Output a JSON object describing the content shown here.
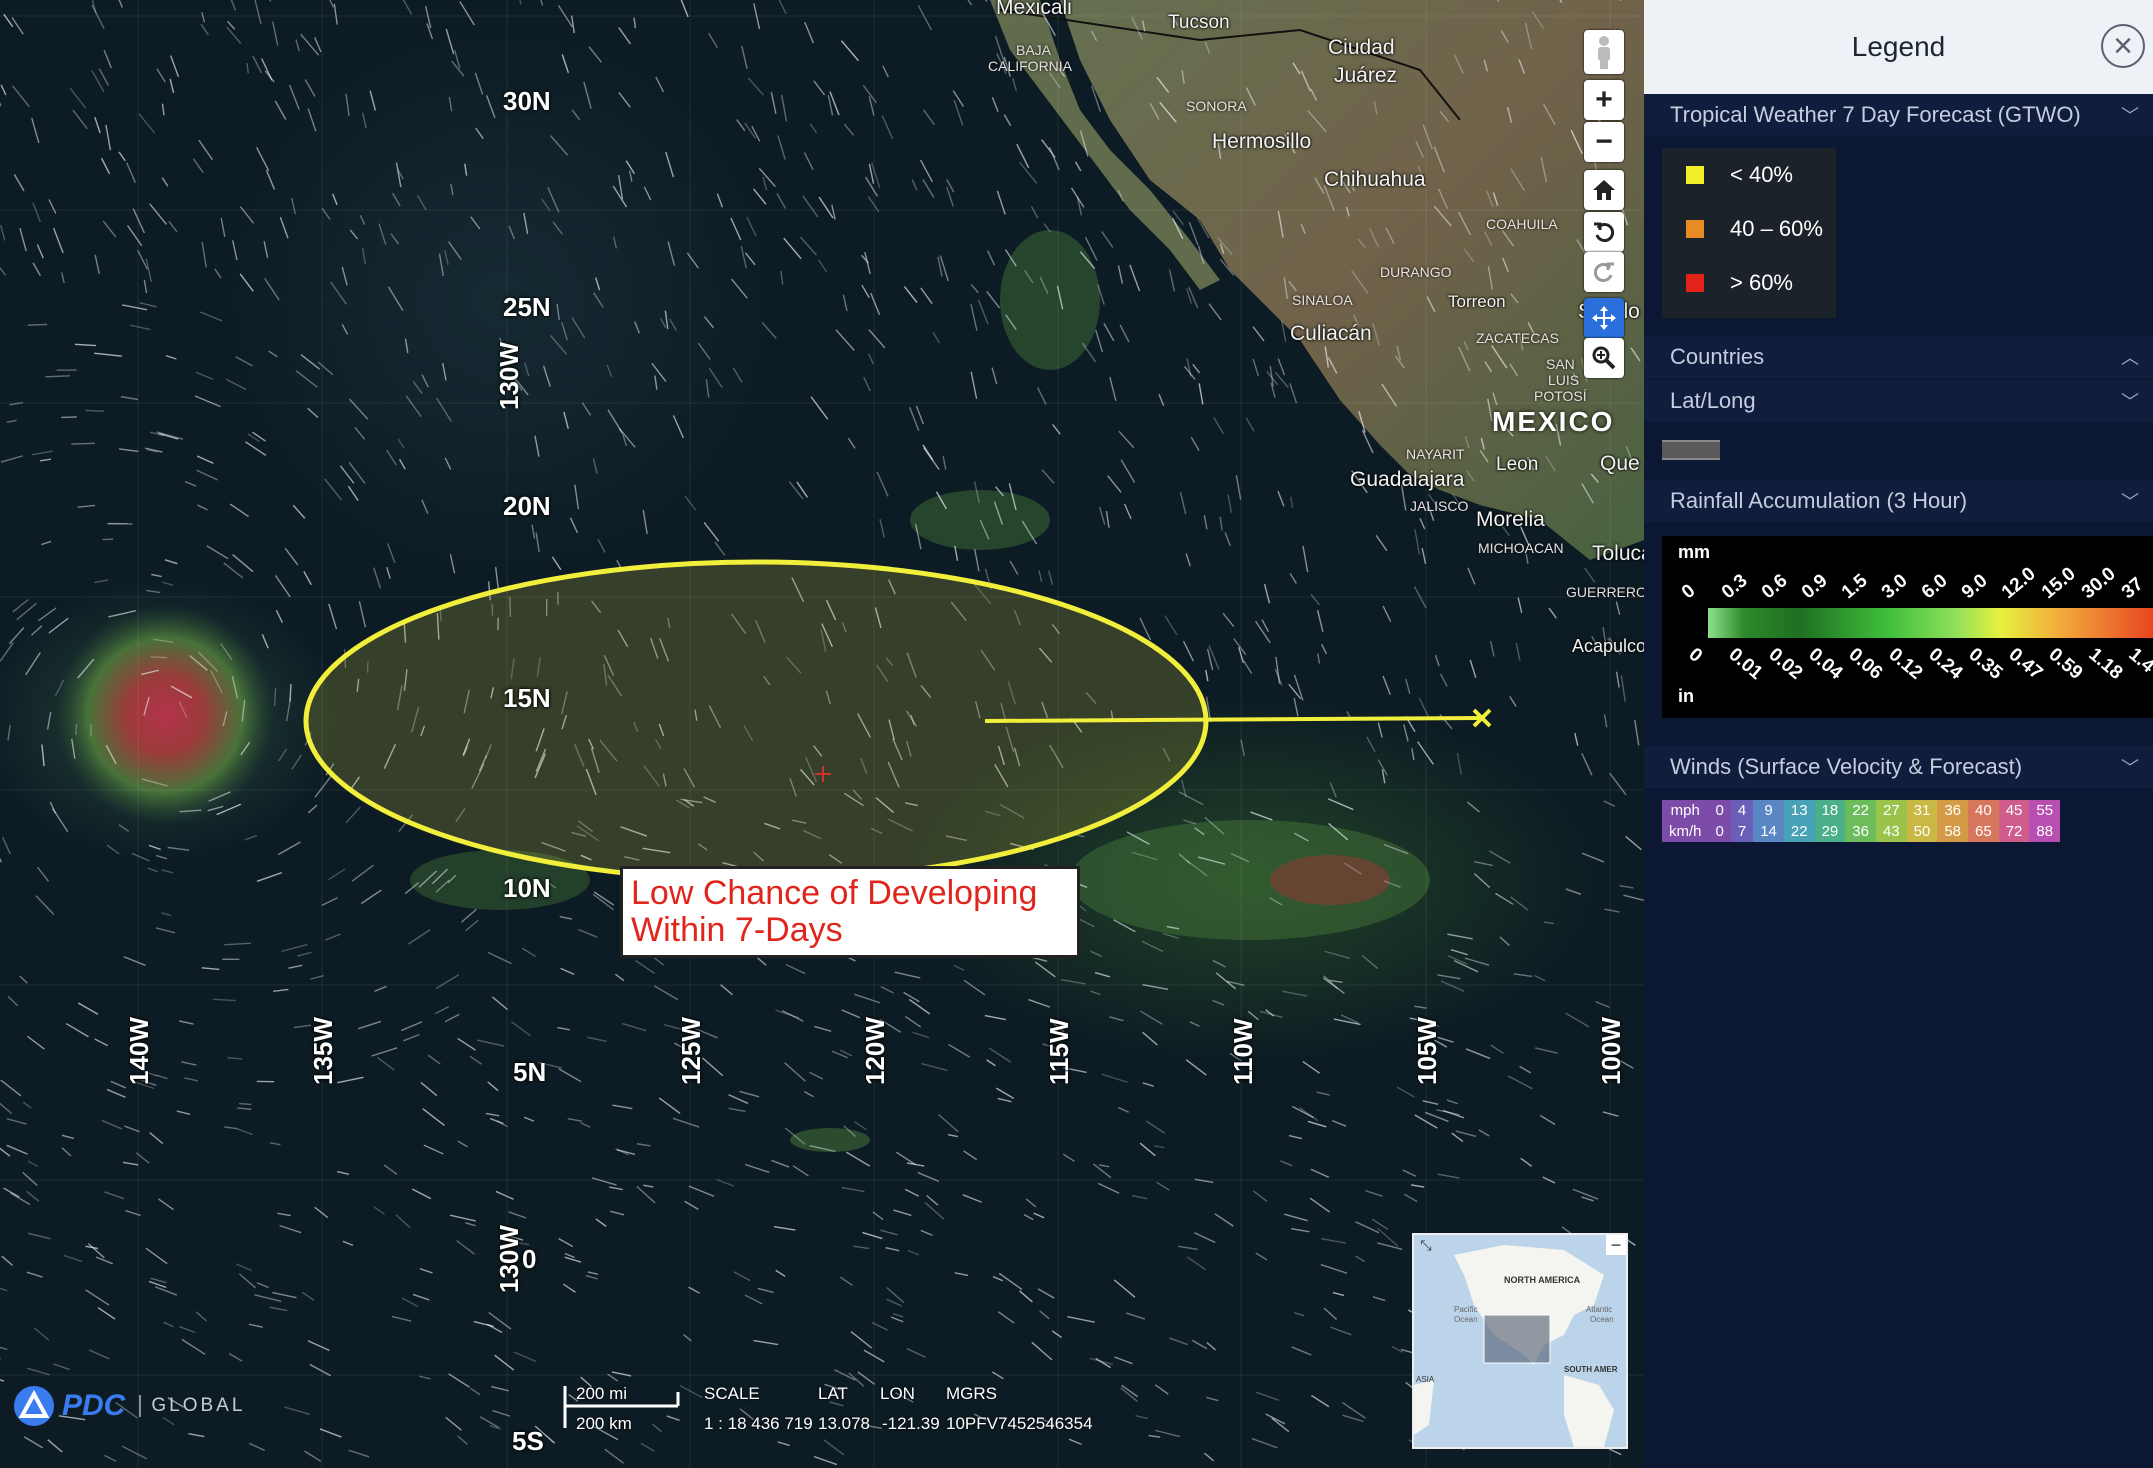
{
  "map": {
    "lat_labels": [
      "30N",
      "25N",
      "20N",
      "15N",
      "10N",
      "5N",
      "0",
      "5S"
    ],
    "lon_labels": [
      "140W",
      "135W",
      "130W",
      "125W",
      "120W",
      "115W",
      "110W",
      "105W",
      "100W"
    ],
    "extra_lon_labels": [
      "130W",
      "130W"
    ],
    "cities": [
      "Mexicali",
      "Tucson",
      "Ciudad",
      "Juárez",
      "Hermosillo",
      "Chihuahua",
      "Culiacán",
      "Saltillo",
      "Guadalajara",
      "Leon",
      "Morelia",
      "Toluca",
      "Acapulco",
      "Que"
    ],
    "states": [
      "BAJA",
      "CALIFORNIA",
      "SONORA",
      "COAHUILA",
      "DURANGO",
      "SINALOA",
      "Torreon",
      "ZACATECAS",
      "SAN",
      "LUIS",
      "POTOSÍ",
      "NAYARIT",
      "JALISCO",
      "MICHOACAN",
      "GUERRERO"
    ],
    "country_label": "MEXICO",
    "callout_lines": [
      "Low Chance of Developing",
      "Within 7-Days"
    ],
    "forecast_area_color": "#f2ee3c",
    "controls": [
      "streetview-icon",
      "zoom-in-icon",
      "zoom-out-icon",
      "home-icon",
      "undo-icon",
      "redo-icon",
      "pan-icon",
      "zoom-box-icon"
    ],
    "scale": {
      "mi": "200 mi",
      "km": "200 km"
    },
    "readout": {
      "scale_label": "SCALE",
      "scale_value": "1 : 18 436 719",
      "lat_label": "LAT",
      "lat_value": "13.078",
      "lon_label": "LON",
      "lon_value": "-121.39",
      "mgrs_label": "MGRS",
      "mgrs_value": "10PFV7452546354"
    },
    "logo": {
      "name": "PDC",
      "suffix": "GLOBAL"
    },
    "minimap_labels": [
      "NORTH AMERICA",
      "Pacific",
      "Ocean",
      "Atlantic",
      "Ocean",
      "SOUTH AMER",
      "ASIA"
    ]
  },
  "legend": {
    "title": "Legend",
    "gtwo": {
      "title": "Tropical Weather 7 Day Forecast (GTWO)",
      "items": [
        {
          "label": "< 40%",
          "color": "#f3ee2a"
        },
        {
          "label": "40 – 60%",
          "color": "#e88a25"
        },
        {
          "label": "> 60%",
          "color": "#e32219"
        }
      ]
    },
    "countries": "Countries",
    "latlong": "Lat/Long",
    "rainfall": {
      "title": "Rainfall Accumulation (3 Hour)",
      "unit_top": "mm",
      "unit_bottom": "in",
      "mm_ticks": [
        "0",
        "0.3",
        "0.6",
        "0.9",
        "1.5",
        "3.0",
        "6.0",
        "9.0",
        "12.0",
        "15.0",
        "30.0",
        "37"
      ],
      "in_ticks": [
        "0",
        "0.01",
        "0.02",
        "0.04",
        "0.06",
        "0.12",
        "0.24",
        "0.35",
        "0.47",
        "0.59",
        "1.18",
        "1.4"
      ]
    },
    "winds": {
      "title": "Winds (Surface Velocity & Forecast)",
      "mph_label": "mph",
      "kmh_label": "km/h",
      "mph": [
        "0",
        "4",
        "9",
        "13",
        "18",
        "22",
        "27",
        "31",
        "36",
        "40",
        "45",
        "55"
      ],
      "kmh": [
        "0",
        "7",
        "14",
        "22",
        "29",
        "36",
        "43",
        "50",
        "58",
        "65",
        "72",
        "88"
      ],
      "colors": [
        "#7d4ca8",
        "#6a5fb8",
        "#5a86c4",
        "#47a2b8",
        "#4bb08a",
        "#6cbc5c",
        "#9bc34c",
        "#c9b843",
        "#d59a45",
        "#d6765a",
        "#cf5c8a",
        "#b84fb0"
      ]
    }
  }
}
